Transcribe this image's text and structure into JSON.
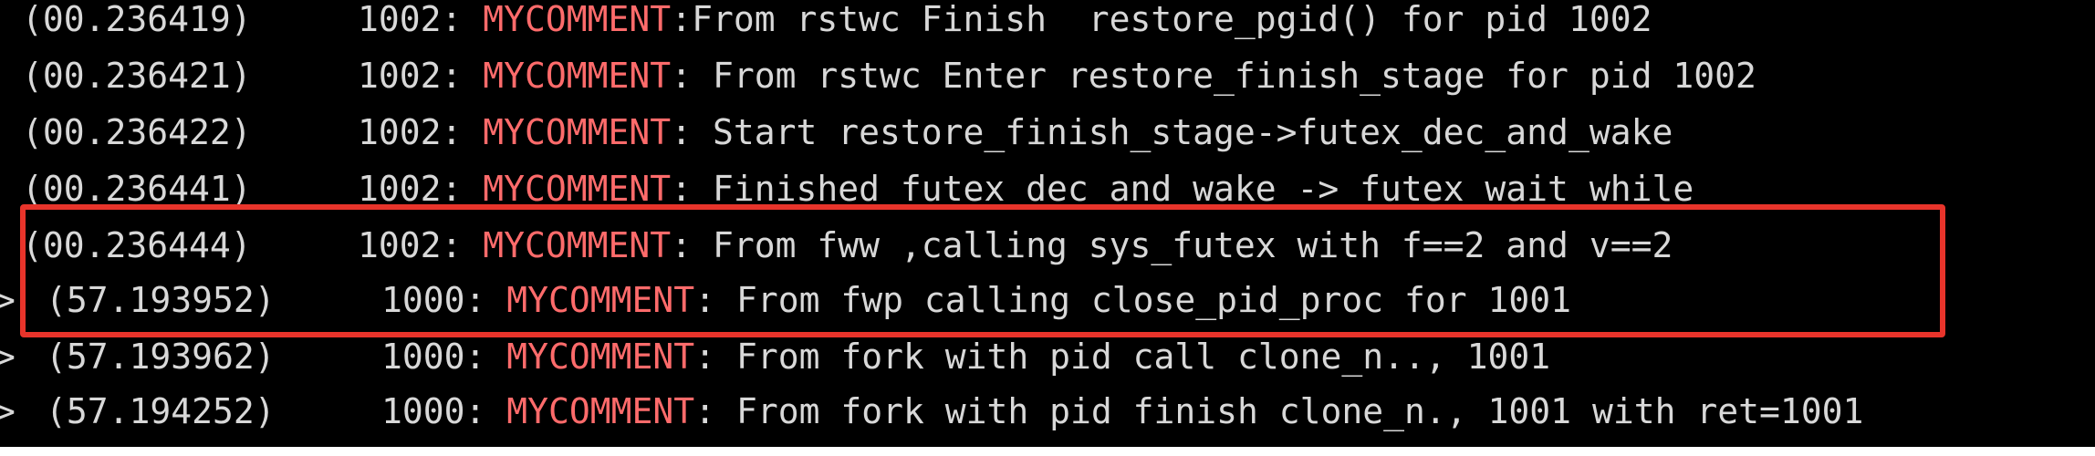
{
  "terminal": {
    "lines": [
      {
        "prompt": "",
        "timestamp": "(00.236419)",
        "pid": "1002:",
        "tag": "MYCOMMENT",
        "message": ":From rstwc Finish  restore_pgid() for pid 1002"
      },
      {
        "prompt": "",
        "timestamp": "(00.236421)",
        "pid": "1002:",
        "tag": "MYCOMMENT",
        "message": ": From rstwc Enter restore_finish_stage for pid 1002"
      },
      {
        "prompt": "",
        "timestamp": "(00.236422)",
        "pid": "1002:",
        "tag": "MYCOMMENT",
        "message": ": Start restore_finish_stage->futex_dec_and_wake"
      },
      {
        "prompt": "",
        "timestamp": "(00.236441)",
        "pid": "1002:",
        "tag": "MYCOMMENT",
        "message": ": Finished futex dec and wake -> futex wait while"
      },
      {
        "prompt": "",
        "timestamp": "(00.236444)",
        "pid": "1002:",
        "tag": "MYCOMMENT",
        "message": ": From fww ,calling sys_futex with f==2 and v==2"
      },
      {
        "prompt": ">",
        "timestamp": "(57.193952)",
        "pid": "1000:",
        "tag": "MYCOMMENT",
        "message": ": From fwp calling close_pid_proc for 1001"
      },
      {
        "prompt": ">",
        "timestamp": "(57.193962)",
        "pid": "1000:",
        "tag": "MYCOMMENT",
        "message": ": From fork with pid call clone_n.., 1001"
      },
      {
        "prompt": ">",
        "timestamp": "(57.194252)",
        "pid": "1000:",
        "tag": "MYCOMMENT",
        "message": ": From fork with pid finish clone_n., 1001 with ret=1001"
      }
    ]
  },
  "colors": {
    "background": "#000000",
    "text": "#d8d8d8",
    "tag": "#ff6b6b",
    "highlight_border": "#e8342b"
  }
}
